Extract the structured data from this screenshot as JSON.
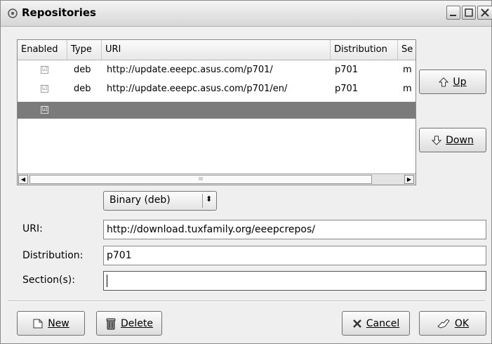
{
  "window": {
    "title": "Repositories"
  },
  "table": {
    "columns": [
      "Enabled",
      "Type",
      "URI",
      "Distribution",
      "Se"
    ],
    "rows": [
      {
        "enabled": true,
        "type": "deb",
        "uri": "http://update.eeepc.asus.com/p701/",
        "distribution": "p701",
        "section": "m"
      },
      {
        "enabled": true,
        "type": "deb",
        "uri": "http://update.eeepc.asus.com/p701/en/",
        "distribution": "p701",
        "section": "m"
      },
      {
        "enabled": true,
        "type": "",
        "uri": "",
        "distribution": "",
        "section": "",
        "selected": true
      }
    ],
    "check_glyph": "☑",
    "scroll_grip": "III"
  },
  "side_buttons": {
    "up": "Up",
    "down": "Down"
  },
  "form": {
    "type_select": "Binary (deb)",
    "uri_label": "URI:",
    "uri_value": "http://download.tuxfamily.org/eeepcrepos/",
    "distribution_label": "Distribution:",
    "distribution_value": "p701",
    "sections_label": "Section(s):",
    "sections_value": ""
  },
  "footer": {
    "new": "New",
    "delete": "Delete",
    "cancel": "Cancel",
    "ok": "OK"
  },
  "colors": {
    "selected_row": "#7b7b7b",
    "background": "#efefef"
  },
  "icons": [
    "repository-icon",
    "minimize-icon",
    "maximize-icon",
    "close-icon",
    "arrow-up-icon",
    "arrow-down-icon",
    "new-document-icon",
    "trash-icon",
    "cancel-x-icon",
    "ok-hand-icon"
  ]
}
